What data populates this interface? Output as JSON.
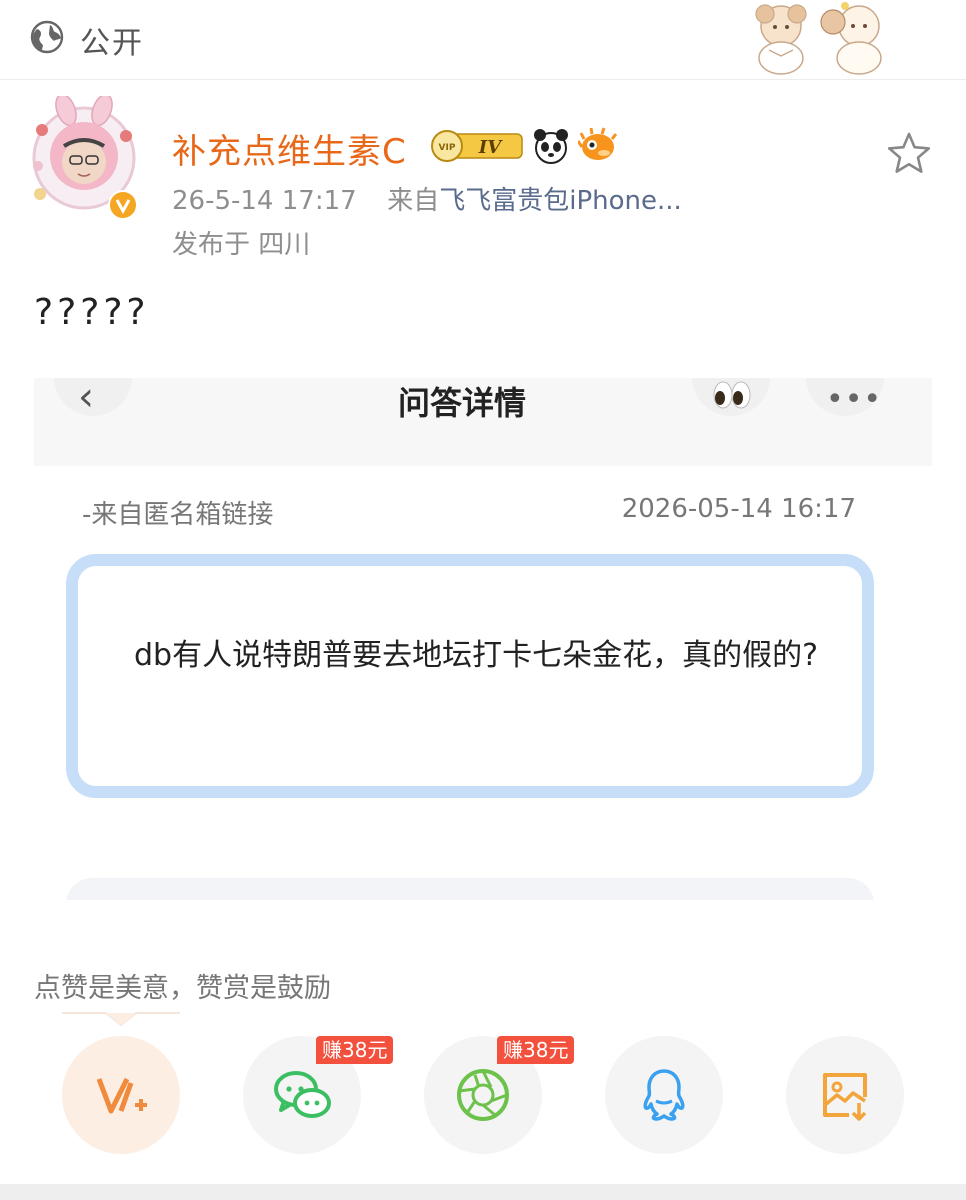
{
  "top_bar": {
    "visibility_label": "公开"
  },
  "post": {
    "username": "补充点维生素C",
    "level_badge": "IV",
    "time": "26-5-14 17:17",
    "source_prefix": "来自",
    "source_name": "飞飞富贵包iPhone...",
    "location": "发布于 四川",
    "text": "?????"
  },
  "embedded_screenshot": {
    "title": "问答详情",
    "from_text": "-来自匿名箱链接",
    "timestamp": "2026-05-14 16:17",
    "question": "db有人说特朗普要去地坛打卡七朵金花，真的假的?"
  },
  "reward": {
    "text": "点赞是美意，赞赏是鼓励"
  },
  "share": {
    "items": [
      {
        "icon": "reward-v-plus-icon"
      },
      {
        "icon": "wechat-icon",
        "badge": "赚38元"
      },
      {
        "icon": "wechat-moments-icon",
        "badge": "赚38元"
      },
      {
        "icon": "qq-icon"
      },
      {
        "icon": "save-image-icon"
      }
    ]
  },
  "colors": {
    "username": "#e8681a",
    "question_border": "#c6def7",
    "earn_badge": "#f3513d",
    "wechat": "#3cbf62",
    "qq": "#3aa0f0",
    "save": "#f3a43a"
  }
}
